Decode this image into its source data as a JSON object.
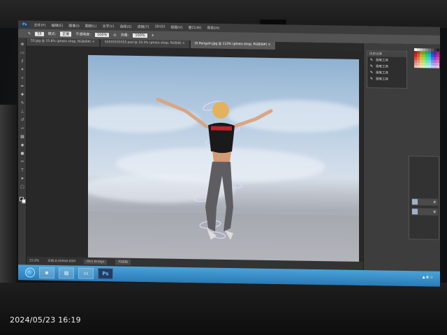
{
  "menubar": {
    "app_badge": "Ps",
    "items": [
      "文件(F)",
      "编辑(E)",
      "图像(I)",
      "图层(L)",
      "文字(Y)",
      "选择(S)",
      "滤镜(T)",
      "3D(D)",
      "视图(V)",
      "窗口(W)",
      "帮助(H)"
    ]
  },
  "options": {
    "size": "15",
    "mode_label": "模式:",
    "mode_value": "正常",
    "opacity_label": "不透明度:",
    "opacity_value": "100%",
    "flow_label": "流量:",
    "flow_value": "100%"
  },
  "tabs": [
    {
      "label": "55.jpg @ 25.8% (photo shop, RGB/8#) ×"
    },
    {
      "label": "55555555555.psd @ 33.3% (photo shop, RGB/8) ×"
    },
    {
      "label": "t5 Penguin.jpg @ 112% (photo shop, RGB/8#) ×"
    }
  ],
  "history": {
    "title": "历史记录",
    "rows": [
      "画笔工具",
      "画笔工具",
      "画笔工具",
      "画笔工具"
    ]
  },
  "status": {
    "zoom": "25.8%",
    "doc": "文档:8.00M/8.00M",
    "mini_tab1": "Mini Bridge",
    "mini_tab2": "时间轴"
  },
  "taskbar": {
    "ps_label": "Ps"
  },
  "photo_timestamp": "2024/05/23 16:19",
  "colors": {
    "sky_top": "#8fb1d1",
    "taskbar": "#2a7ab6",
    "swirl": "#e8d8ff"
  }
}
